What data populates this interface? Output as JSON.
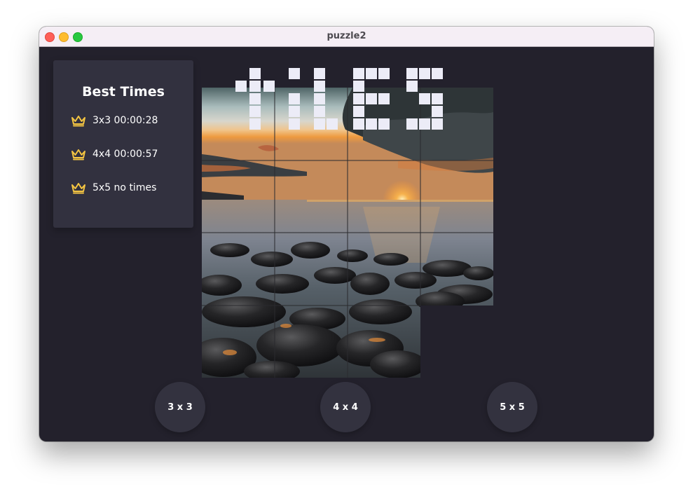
{
  "window": {
    "title": "puzzle2"
  },
  "best_times": {
    "title": "Best Times",
    "entries": [
      {
        "label": "3x3 00:00:28",
        "icon": "crown-icon"
      },
      {
        "label": "4x4 00:00:57",
        "icon": "crown-icon"
      },
      {
        "label": "5x5 no times",
        "icon": "crown-icon"
      }
    ]
  },
  "logo_text": "tiles",
  "board": {
    "grid": 4,
    "tiles": 15,
    "image": "sunset-over-rocky-beach"
  },
  "buttons": {
    "b3": "3 x 3",
    "b4": "4 x 4",
    "b5": "5 x 5"
  },
  "colors": {
    "background": "#23212c",
    "panel": "#32313f",
    "crown": "#f4c542",
    "logo": "#ececf7",
    "button": "#33323f"
  }
}
